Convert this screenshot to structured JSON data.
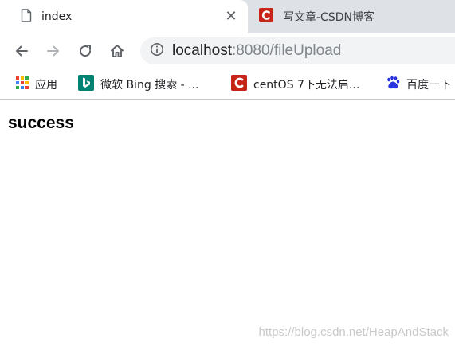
{
  "tabs": [
    {
      "title": "index",
      "active": true,
      "icon": "page-icon"
    },
    {
      "title": "写文章-CSDN博客",
      "active": false,
      "icon": "csdn-icon"
    }
  ],
  "toolbar": {
    "url_host": "localhost",
    "url_rest": ":8080/fileUpload"
  },
  "bookmarks": [
    {
      "label": "应用",
      "icon": "apps-grid-icon"
    },
    {
      "label": "微软 Bing 搜索 - ...",
      "icon": "bing-icon"
    },
    {
      "label": "centOS 7下无法启...",
      "icon": "csdn-icon"
    },
    {
      "label": "百度一下",
      "icon": "baidu-icon"
    }
  ],
  "page": {
    "heading": "success",
    "watermark": "https://blog.csdn.net/HeapAndStack"
  },
  "colors": {
    "tab_strip": "#dee1e6",
    "omnibox": "#f1f3f4",
    "csdn_red": "#c9241a",
    "bing_teal": "#008373",
    "baidu_blue": "#2932e1"
  }
}
